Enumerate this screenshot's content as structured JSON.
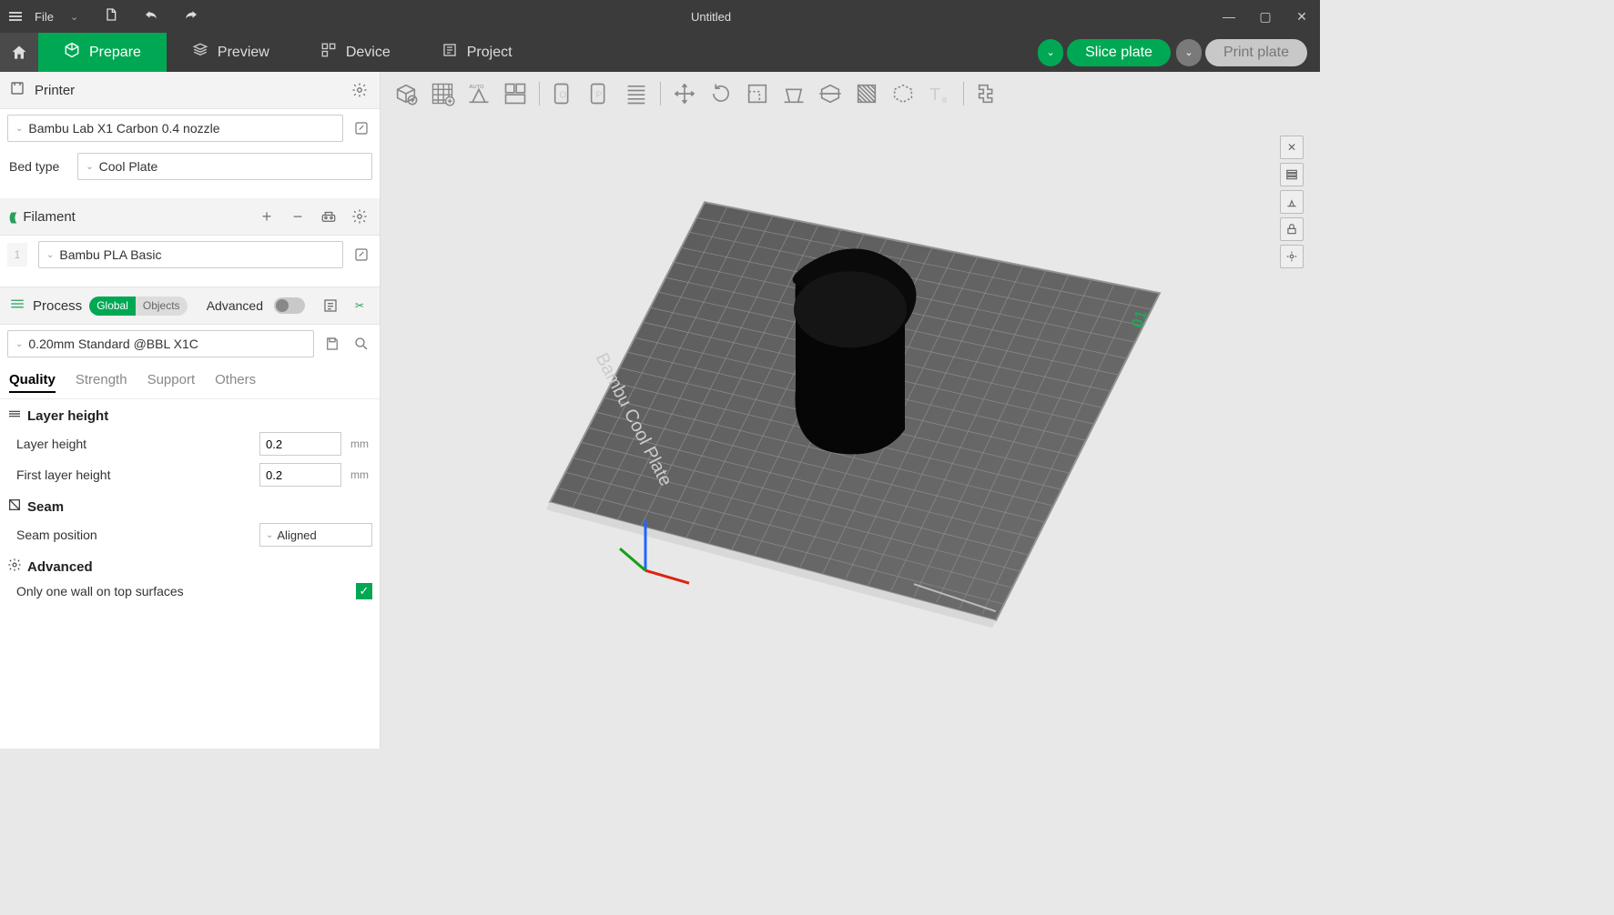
{
  "titlebar": {
    "file_label": "File",
    "title": "Untitled"
  },
  "tabs": {
    "prepare": "Prepare",
    "preview": "Preview",
    "device": "Device",
    "project": "Project",
    "slice": "Slice plate",
    "print": "Print plate"
  },
  "printer": {
    "section": "Printer",
    "selected": "Bambu Lab X1 Carbon 0.4 nozzle",
    "bed_type_label": "Bed type",
    "bed_type_value": "Cool Plate"
  },
  "filament": {
    "section": "Filament",
    "index": "1",
    "selected": "Bambu PLA Basic"
  },
  "process": {
    "section": "Process",
    "global": "Global",
    "objects": "Objects",
    "advanced": "Advanced",
    "preset": "0.20mm Standard @BBL X1C",
    "tabs": {
      "quality": "Quality",
      "strength": "Strength",
      "support": "Support",
      "others": "Others"
    },
    "groups": {
      "layer_height": {
        "title": "Layer height",
        "layer_height_label": "Layer height",
        "layer_height_value": "0.2",
        "first_layer_label": "First layer height",
        "first_layer_value": "0.2",
        "unit": "mm"
      },
      "seam": {
        "title": "Seam",
        "position_label": "Seam position",
        "position_value": "Aligned"
      },
      "advanced_grp": {
        "title": "Advanced",
        "one_wall_label": "Only one wall on top surfaces",
        "one_wall_checked": true
      }
    }
  },
  "plate": {
    "label": "Bambu Cool Plate",
    "number": "01"
  }
}
